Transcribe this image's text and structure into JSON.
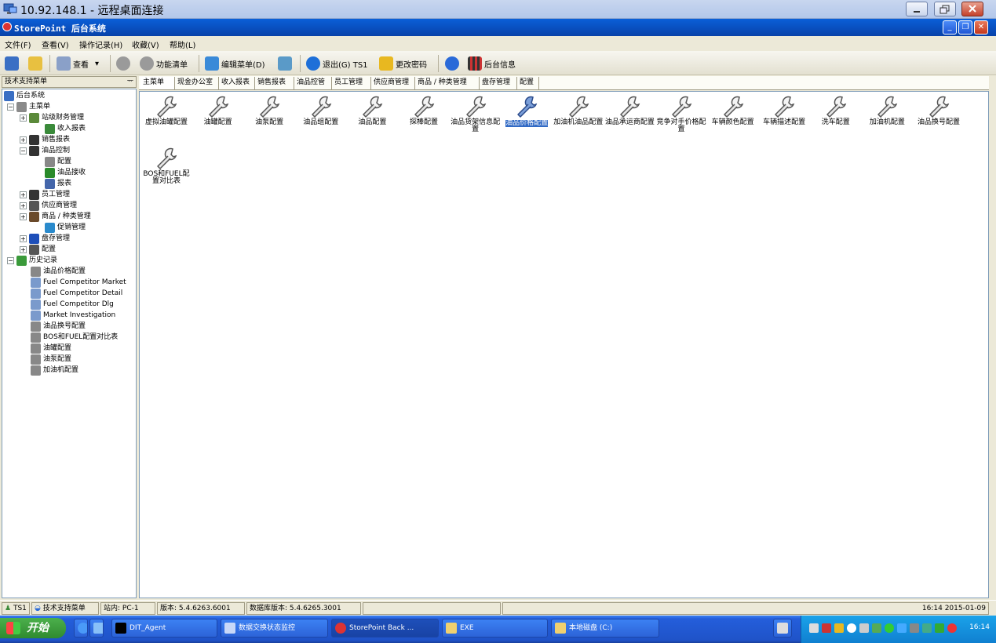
{
  "rdp": {
    "title": "10.92.148.1 - 远程桌面连接"
  },
  "app": {
    "title": "StorePoint 后台系统"
  },
  "menu": [
    "文件(F)",
    "查看(V)",
    "操作记录(H)",
    "收藏(V)",
    "帮助(L)"
  ],
  "toolbar": {
    "view": "查看",
    "function_list": "功能清单",
    "edit_menu": "编辑菜单(D)",
    "exit": "退出(G) TS1",
    "change_password": "更改密码",
    "backend_info": "后台信息"
  },
  "panel": {
    "title": "技术支持菜单",
    "pin": "ᅲ"
  },
  "tree": [
    {
      "label": "后台系统",
      "icon": "computer-icon",
      "color": "#3a6fc4"
    },
    {
      "label": "主菜单",
      "icon": "folder-icon",
      "color": "#8a8a8a",
      "exp": "−"
    },
    {
      "label": "站级财务管理",
      "icon": "ledger-icon",
      "color": "#5b8a3a",
      "exp": "+"
    },
    {
      "label": "收入报表",
      "icon": "report-icon",
      "color": "#3a8a3a"
    },
    {
      "label": "销售报表",
      "icon": "chart-icon",
      "color": "#333333",
      "exp": "+"
    },
    {
      "label": "油品控制",
      "icon": "fuel-pump-icon",
      "color": "#333333",
      "exp": "−"
    },
    {
      "label": "配置",
      "icon": "wrench-icon",
      "color": "#888888"
    },
    {
      "label": "油品接收",
      "icon": "traffic-light-icon",
      "color": "#2a8a2a"
    },
    {
      "label": "报表",
      "icon": "printer-icon",
      "color": "#4466aa"
    },
    {
      "label": "员工管理",
      "icon": "people-icon",
      "color": "#333333",
      "exp": "+"
    },
    {
      "label": "供应商管理",
      "icon": "gear-icon",
      "color": "#555555",
      "exp": "+"
    },
    {
      "label": "商品 / 种类管理",
      "icon": "goods-icon",
      "color": "#6a4a2a",
      "exp": "+"
    },
    {
      "label": "促销管理",
      "icon": "promotion-icon",
      "color": "#2a8acc"
    },
    {
      "label": "盘存管理",
      "icon": "info-icon",
      "color": "#1e4fb9",
      "exp": "+"
    },
    {
      "label": "配置",
      "icon": "tools-icon",
      "color": "#555555",
      "exp": "+"
    },
    {
      "label": "历史记录",
      "icon": "history-icon",
      "color": "#3a9a3a",
      "exp": "−"
    },
    {
      "label": "油品价格配置",
      "icon": "wrench-icon",
      "color": "#888888"
    },
    {
      "label": "Fuel Competitor Market",
      "icon": "doc-icon",
      "color": "#7a9acc"
    },
    {
      "label": "Fuel Competitor Detail",
      "icon": "doc-icon",
      "color": "#7a9acc"
    },
    {
      "label": "Fuel Competitor Dlg",
      "icon": "doc-icon",
      "color": "#7a9acc"
    },
    {
      "label": "Market Investigation",
      "icon": "doc-icon",
      "color": "#7a9acc"
    },
    {
      "label": "油品换号配置",
      "icon": "wrench-icon",
      "color": "#888888"
    },
    {
      "label": "BOS和FUEL配置对比表",
      "icon": "wrench-icon",
      "color": "#888888"
    },
    {
      "label": "油罐配置",
      "icon": "wrench-icon",
      "color": "#888888"
    },
    {
      "label": "油泵配置",
      "icon": "wrench-icon",
      "color": "#888888"
    },
    {
      "label": "加油机配置",
      "icon": "wrench-icon",
      "color": "#888888"
    }
  ],
  "tabs": [
    "主菜单",
    "现金办公室",
    "收入报表",
    "销售报表",
    "油品控管",
    "员工管理",
    "供应商管理",
    "商品 / 种类管理",
    "盘存管理",
    "配置"
  ],
  "tiles": [
    "虚拟油罐配置",
    "油罐配置",
    "油泵配置",
    "油品组配置",
    "油品配置",
    "探棒配置",
    "油品货架信息配置",
    "油品价格配置",
    "加油机油品配置",
    "油品承运商配置",
    "竞争对手价格配置",
    "车辆颜色配置",
    "车辆描述配置",
    "洗车配置",
    "加油机配置",
    "油品换号配置",
    "BOS和FUEL配置对比表"
  ],
  "selected_tile": "油品价格配置",
  "status": {
    "user": "TS1",
    "menu": "技术支持菜单",
    "site": "站内: PC-1",
    "version": "版本: 5.4.6263.6001",
    "db_version": "数据库版本: 5.4.6265.3001",
    "datetime": "16:14 2015-01-09"
  },
  "taskbar": {
    "start": "开始",
    "tasks": [
      "DIT_Agent",
      "数据交换状态监控",
      "StorePoint Back ...",
      "EXE",
      "本地磁盘 (C:)"
    ],
    "clock": "16:14"
  }
}
